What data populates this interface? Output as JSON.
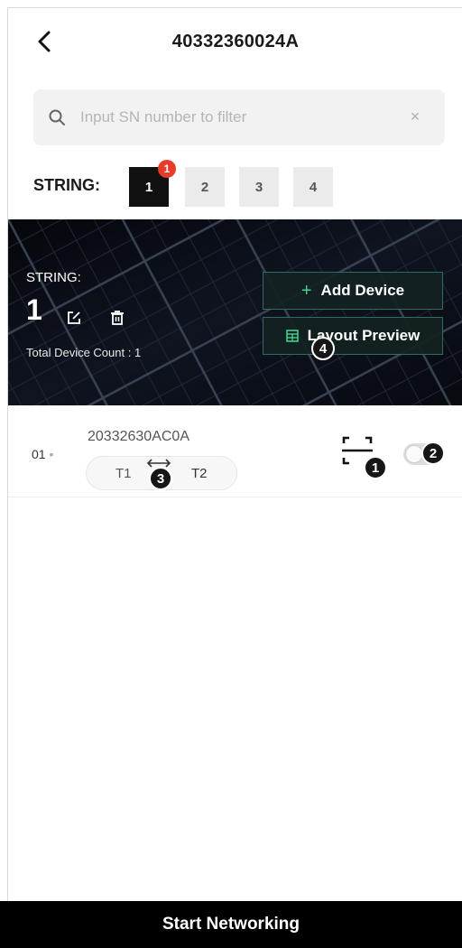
{
  "header": {
    "title": "40332360024A",
    "back_icon": "chevron-left-icon"
  },
  "search": {
    "placeholder": "Input SN number to filter",
    "value": "",
    "clear_icon": "close-icon",
    "clear_glyph": "×"
  },
  "strings": {
    "label": "STRING:",
    "tabs": [
      {
        "label": "1",
        "active": true,
        "badge": "1"
      },
      {
        "label": "2",
        "active": false
      },
      {
        "label": "3",
        "active": false
      },
      {
        "label": "4",
        "active": false
      }
    ]
  },
  "banner": {
    "label": "STRING:",
    "number": "1",
    "count_text": "Total Device Count : 1",
    "add_device_label": "Add Device",
    "layout_preview_label": "Layout Preview",
    "add_glyph": "+"
  },
  "device": {
    "index": "01",
    "dot": "•",
    "sn": "20332630AC0A",
    "t1": "T1",
    "t2": "T2",
    "enabled": false
  },
  "markers": {
    "m1": "1",
    "m2": "2",
    "m3": "3",
    "m4": "4"
  },
  "footer": {
    "start_label": "Start Networking"
  },
  "colors": {
    "accent_green": "#3fd28e",
    "badge_red": "#e83b2a",
    "primary": "#000000"
  }
}
